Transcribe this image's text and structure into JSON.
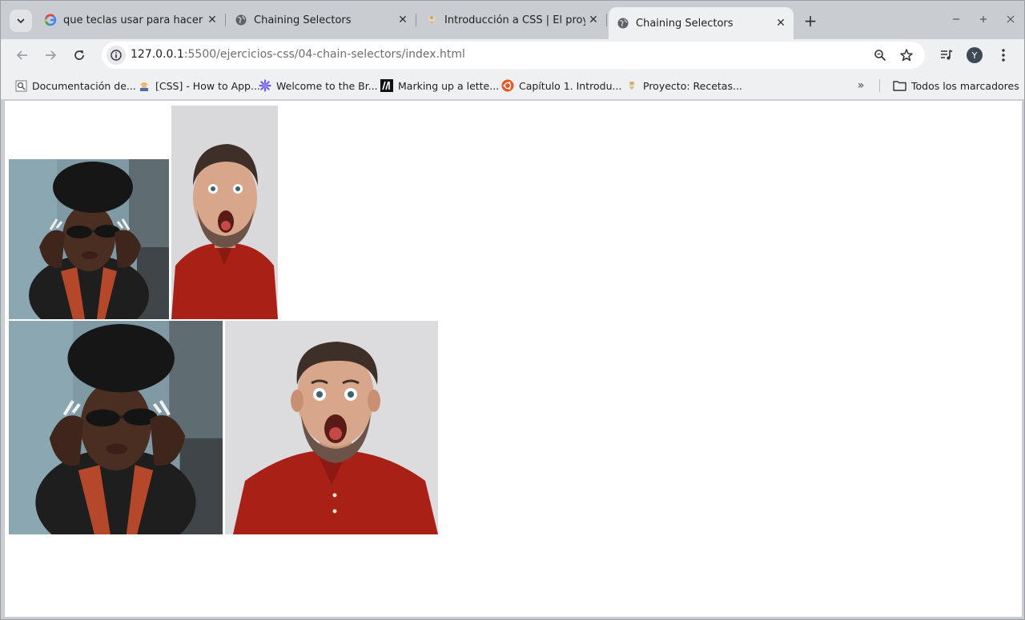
{
  "browser": {
    "tabs": [
      {
        "title": "que teclas usar para hacer un",
        "favicon": "google-icon",
        "active": false
      },
      {
        "title": "Chaining Selectors",
        "favicon": "globe-icon",
        "active": false
      },
      {
        "title": "Introducción a CSS | El proyec",
        "favicon": "odin-icon",
        "active": false
      },
      {
        "title": "Chaining Selectors",
        "favicon": "globe-icon",
        "active": true
      }
    ],
    "new_tab": "+",
    "url_host": "127.0.0.1",
    "url_path": ":5500/ejercicios-css/04-chain-selectors/index.html",
    "profile_initial": "Y"
  },
  "bookmarks": {
    "items": [
      {
        "label": "Documentación de...",
        "icon": "doc-search-icon"
      },
      {
        "label": "[CSS] - How to App...",
        "icon": "construction-icon"
      },
      {
        "label": "Welcome to the Br...",
        "icon": "gear-flower-icon"
      },
      {
        "label": "Marking up a lette...",
        "icon": "mdn-icon"
      },
      {
        "label": "Capítulo 1. Introdu...",
        "icon": "ubuntu-icon"
      },
      {
        "label": "Proyecto: Recetas...",
        "icon": "odin-icon"
      }
    ],
    "more": "»",
    "all_bookmarks": "Todos los marcadores"
  },
  "page": {
    "images": [
      {
        "alt": "woman-with-sunglasses-photo",
        "row": 1
      },
      {
        "alt": "surprised-man-photo",
        "row": 1
      },
      {
        "alt": "woman-with-sunglasses-photo",
        "row": 2
      },
      {
        "alt": "surprised-man-photo",
        "row": 2
      }
    ]
  },
  "colors": {
    "chrome_bg": "#c9ccd1",
    "toolbar_bg": "#eef0f2",
    "page_bg": "#ffffff"
  }
}
